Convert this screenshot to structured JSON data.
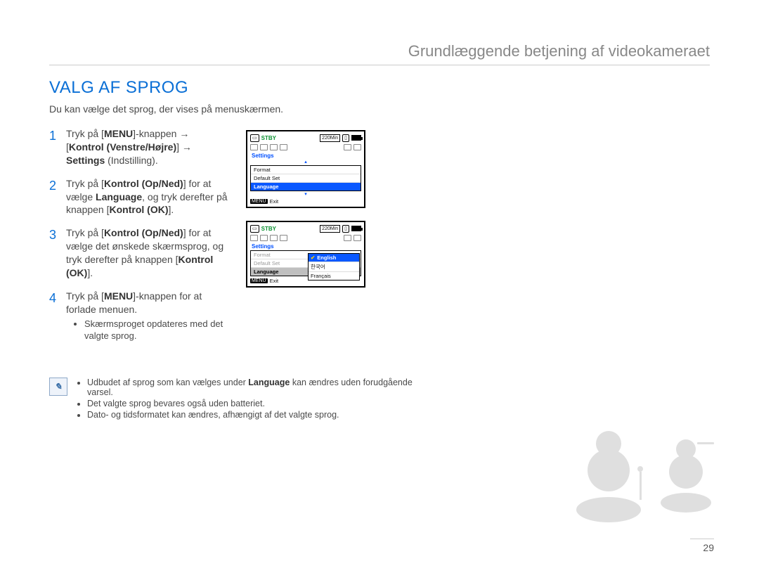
{
  "chapter_title": "Grundlæggende betjening af videokameraet",
  "section_title": "VALG AF SPROG",
  "intro": "Du kan vælge det sprog, der vises på menuskærmen.",
  "steps": [
    {
      "num": "1",
      "parts": [
        "Tryk på [",
        "MENU",
        "]-knappen ",
        "→",
        " [",
        "Kontrol (Venstre/Højre)",
        "] ",
        "→",
        " ",
        "Settings",
        " (Indstilling)."
      ]
    },
    {
      "num": "2",
      "parts": [
        "Tryk på [",
        "Kontrol (Op/Ned)",
        "] for at vælge ",
        "Language",
        ", og tryk derefter på knappen [",
        "Kontrol (OK)",
        "]."
      ]
    },
    {
      "num": "3",
      "parts": [
        "Tryk på [",
        "Kontrol (Op/Ned)",
        "] for at vælge det ønskede skærmsprog, og tryk derefter på knappen [",
        "Kontrol (OK)",
        "]."
      ]
    },
    {
      "num": "4",
      "parts": [
        "Tryk på [",
        "MENU",
        "]-knappen for at forlade menuen."
      ],
      "bullet": "Skærmsproget opdateres med det valgte sprog."
    }
  ],
  "note_prefix": "Udbudet af sprog som kan vælges under ",
  "note_bold": "Language",
  "note_suffix": " kan ændres uden forudgående varsel.",
  "notes_rest": [
    "Det valgte sprog bevares også uden batteriet.",
    "Dato- og tidsformatet kan ændres, afhængigt af det valgte sprog."
  ],
  "lcd": {
    "stby": "STBY",
    "time": "220Min",
    "settings": "Settings",
    "items": [
      "Format",
      "Default Set",
      "Language"
    ],
    "menu_label": "MENU",
    "exit": "Exit",
    "popup": [
      "English",
      "한국어",
      "Français"
    ]
  },
  "page_number": "29"
}
